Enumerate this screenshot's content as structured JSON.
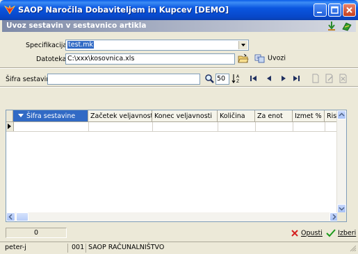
{
  "window": {
    "title": "SAOP  Naročila Dobaviteljem in Kupcev [DEMO]",
    "subtitle": "Uvoz sestavin v sestavnico artikla"
  },
  "form": {
    "specifikacija_label": "Specifikacija",
    "specifikacija_value": "test.mk",
    "datoteka_label": "Datoteka",
    "datoteka_value": "C:\\xxx\\kosovnica.xls",
    "uvozi_label": "Uvozi"
  },
  "search": {
    "label": "Šifra sestavine",
    "value": "",
    "count": "50"
  },
  "grid": {
    "columns": [
      "Šifra sestavine",
      "Začetek veljavnosti",
      "Konec veljavnosti",
      "Količina",
      "Za enot",
      "Izmet %",
      "Risba"
    ],
    "rows": []
  },
  "footer": {
    "record_count": "0",
    "cancel_label": "Opusti",
    "confirm_label": "Izberi"
  },
  "status": {
    "user": "peter-j",
    "code": "001",
    "company": "SAOP RAČUNALNIŠTVO"
  },
  "colors": {
    "titlebar": "#0a56e0",
    "selection": "#316ac5",
    "cancel_x": "#d42020",
    "confirm_check": "#1a9a1a"
  }
}
